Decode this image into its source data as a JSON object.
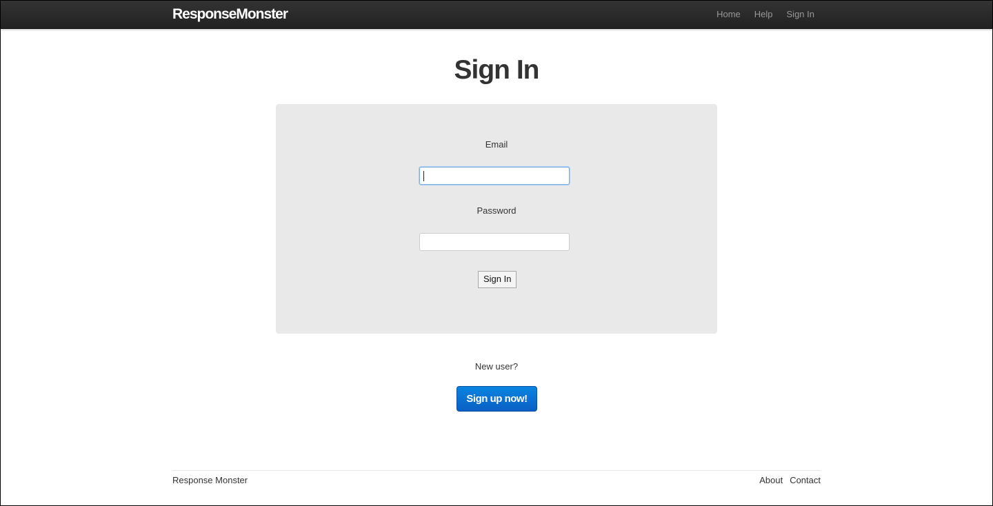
{
  "navbar": {
    "brand": "ResponseMonster",
    "links": [
      {
        "label": "Home"
      },
      {
        "label": "Help"
      },
      {
        "label": "Sign In"
      }
    ]
  },
  "main": {
    "title": "Sign In",
    "form": {
      "email_label": "Email",
      "email_value": "",
      "password_label": "Password",
      "password_value": "",
      "submit_label": "Sign In"
    },
    "new_user_text": "New user?",
    "signup_label": "Sign up now!"
  },
  "footer": {
    "brand": "Response Monster",
    "links": [
      {
        "label": "About"
      },
      {
        "label": "Contact"
      }
    ]
  },
  "colors": {
    "navbar_bg": "#222222",
    "brand_text": "#ffffff",
    "nav_link": "#999999",
    "well_bg": "#e9e9ea",
    "primary_button": "#0a6fd3",
    "text": "#333333"
  }
}
